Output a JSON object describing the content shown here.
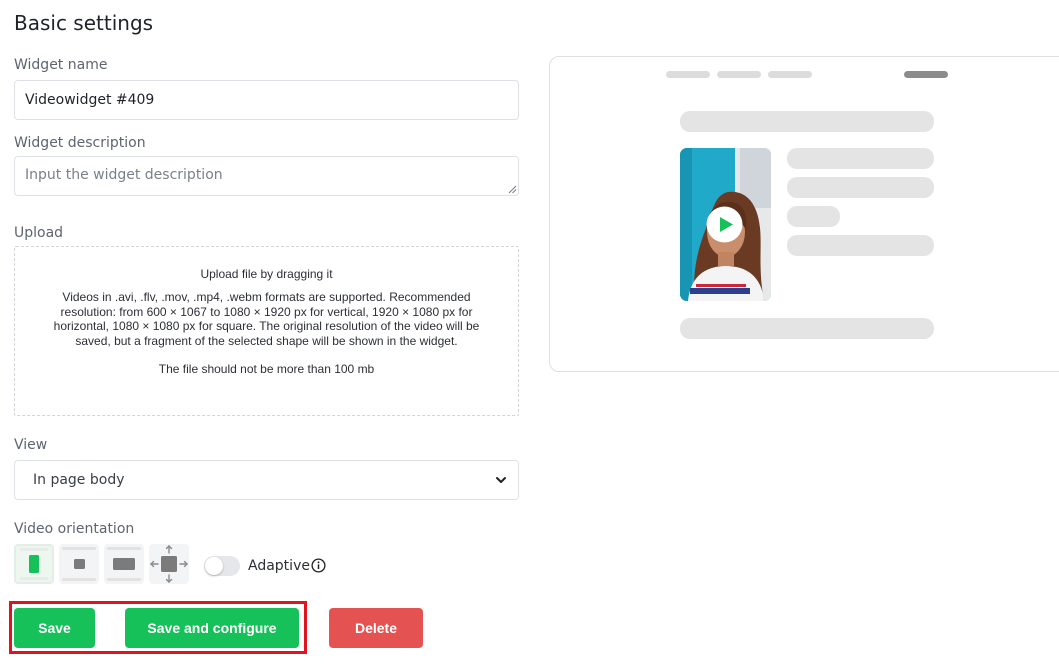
{
  "page": {
    "title": "Basic settings"
  },
  "form": {
    "widget_name": {
      "label": "Widget name",
      "value": "Videowidget #409"
    },
    "widget_description": {
      "label": "Widget description",
      "placeholder": "Input the widget description"
    },
    "upload": {
      "label": "Upload",
      "title": "Upload file by dragging it",
      "description": "Videos in .avi, .flv, .mov, .mp4, .webm formats are supported. Recommended resolution: from 600 × 1067 to 1080 × 1920 px for vertical, 1920 × 1080 px for horizontal, 1080 × 1080 px for square. The original resolution of the video will be saved, but a fragment of the selected shape will be shown in the widget.",
      "limit": "The file should not be more than 100 mb"
    },
    "view": {
      "label": "View",
      "selected": "In page body"
    },
    "orientation": {
      "label": "Video orientation",
      "options": [
        "vertical-orientation-icon",
        "square-orientation-icon",
        "horizontal-orientation-icon",
        "free-resize-orientation-icon"
      ],
      "selected": "vertical",
      "adaptive_label": "Adaptive",
      "adaptive_on": false
    }
  },
  "actions": {
    "save": "Save",
    "save_configure": "Save and configure",
    "delete": "Delete"
  },
  "colors": {
    "accent_green": "#16c15a",
    "danger_red": "#e55252",
    "highlight": "#e0141e",
    "placeholder_gray": "#e4e4e4"
  }
}
